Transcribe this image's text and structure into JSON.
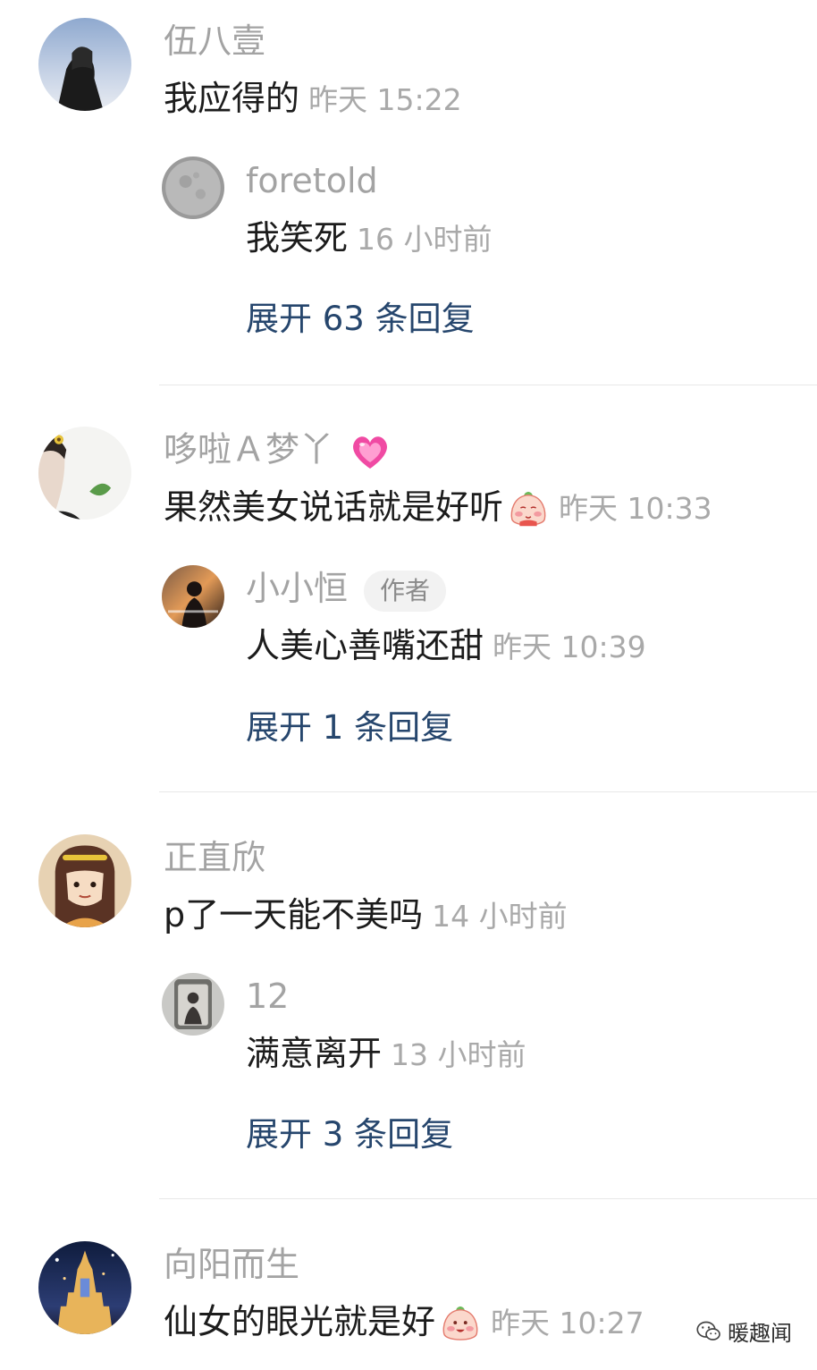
{
  "comments": [
    {
      "user": "伍八壹",
      "text": "我应得的",
      "time": "昨天 15:22",
      "reply": {
        "user": "foretold",
        "text": "我笑死",
        "time": "16 小时前"
      },
      "expand": "展开 63 条回复"
    },
    {
      "user": "哆啦Ａ梦丫",
      "user_emoji": "pink-heart-emoji",
      "text": "果然美女说话就是好听",
      "text_emoji": "peach-blush-emoji",
      "time": "昨天 10:33",
      "reply": {
        "user": "小小恒",
        "badge": "作者",
        "text": "人美心善嘴还甜",
        "time": "昨天 10:39"
      },
      "expand": "展开 1 条回复"
    },
    {
      "user": "正直欣",
      "text": "p了一天能不美吗",
      "time": "14 小时前",
      "reply": {
        "user": "12",
        "text": "满意离开",
        "time": "13 小时前"
      },
      "expand": "展开 3 条回复"
    },
    {
      "user": "向阳而生",
      "text": "仙女的眼光就是好",
      "text_emoji": "peach-grin-emoji",
      "time": "昨天 10:27"
    }
  ],
  "watermark": {
    "text": "暖趣闻"
  },
  "colors": {
    "username": "#a3a3a3",
    "text": "#1c1c1c",
    "timestamp": "#a9a9a9",
    "expand_link": "#26466d",
    "divider": "#e8e8e8",
    "badge_bg": "#f2f2f2"
  }
}
